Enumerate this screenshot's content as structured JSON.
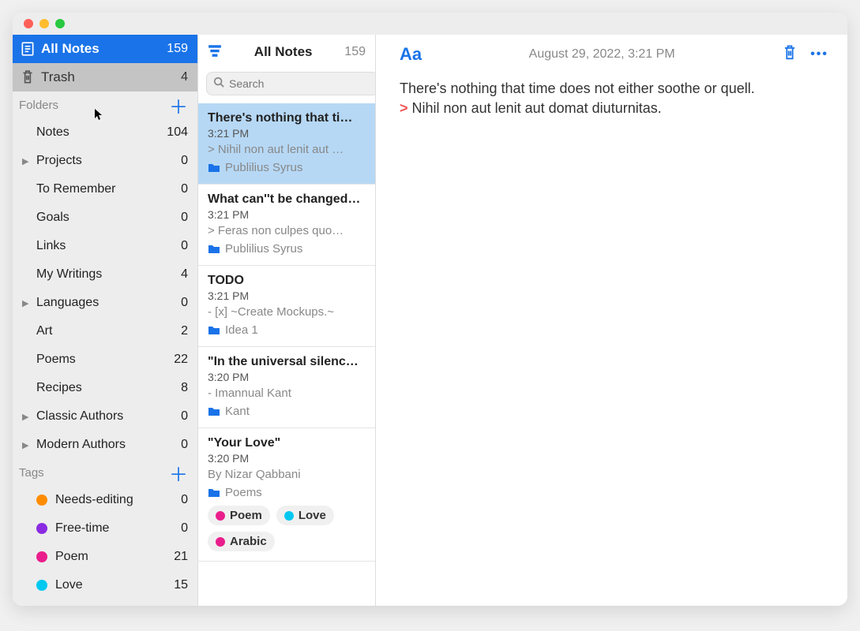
{
  "sidebar": {
    "all_notes": {
      "label": "All Notes",
      "count": "159"
    },
    "trash": {
      "label": "Trash",
      "count": "4"
    },
    "folders_header": "Folders",
    "tags_header": "Tags",
    "folders": [
      {
        "label": "Notes",
        "count": "104",
        "disclosure": false
      },
      {
        "label": "Projects",
        "count": "0",
        "disclosure": true
      },
      {
        "label": "To Remember",
        "count": "0",
        "disclosure": false
      },
      {
        "label": "Goals",
        "count": "0",
        "disclosure": false
      },
      {
        "label": "Links",
        "count": "0",
        "disclosure": false
      },
      {
        "label": "My Writings",
        "count": "4",
        "disclosure": false
      },
      {
        "label": "Languages",
        "count": "0",
        "disclosure": true
      },
      {
        "label": "Art",
        "count": "2",
        "disclosure": false
      },
      {
        "label": "Poems",
        "count": "22",
        "disclosure": false
      },
      {
        "label": "Recipes",
        "count": "8",
        "disclosure": false
      },
      {
        "label": "Classic Authors",
        "count": "0",
        "disclosure": true
      },
      {
        "label": "Modern Authors",
        "count": "0",
        "disclosure": true
      }
    ],
    "tags": [
      {
        "label": "Needs-editing",
        "count": "0",
        "color": "#ff8c00"
      },
      {
        "label": "Free-time",
        "count": "0",
        "color": "#8a2be2"
      },
      {
        "label": "Poem",
        "count": "21",
        "color": "#e91e8c"
      },
      {
        "label": "Love",
        "count": "15",
        "color": "#00c8f0"
      }
    ]
  },
  "notelist": {
    "header_title": "All Notes",
    "header_count": "159",
    "search_placeholder": "Search",
    "notes": [
      {
        "title": "There's nothing that ti…",
        "time": "3:21 PM",
        "preview": "> Nihil non aut lenit aut …",
        "folder": "Publilius Syrus",
        "selected": true,
        "tags": []
      },
      {
        "title": "What can''t be changed…",
        "time": "3:21 PM",
        "preview": "> Feras non culpes quo…",
        "folder": "Publilius Syrus",
        "selected": false,
        "tags": []
      },
      {
        "title": "TODO",
        "time": "3:21 PM",
        "preview": "- [x]  ~Create Mockups.~",
        "folder": "Idea 1",
        "selected": false,
        "tags": []
      },
      {
        "title": "\"In the universal silenc…",
        "time": "3:20 PM",
        "preview": "- Imannual Kant",
        "folder": "Kant",
        "selected": false,
        "tags": []
      },
      {
        "title": "\"Your Love\"",
        "time": "3:20 PM",
        "preview": "By Nizar Qabbani",
        "folder": "Poems",
        "selected": false,
        "tags": [
          {
            "label": "Poem",
            "color": "#e91e8c"
          },
          {
            "label": "Love",
            "color": "#00c8f0"
          },
          {
            "label": "Arabic",
            "color": "#e91e8c"
          }
        ]
      }
    ]
  },
  "editor": {
    "date": "August 29, 2022, 3:21 PM",
    "line1": "There's nothing that time does not either soothe or quell.",
    "quote_marker": ">",
    "line2": "Nihil non aut lenit aut domat diuturnitas."
  }
}
